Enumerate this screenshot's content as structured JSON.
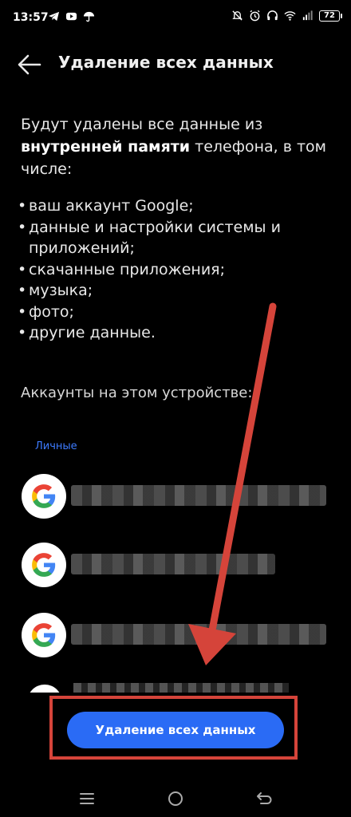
{
  "status_bar": {
    "time": "13:57",
    "battery": "72",
    "left_icons": [
      "telegram-icon",
      "youtube-icon",
      "umbrella-icon"
    ],
    "right_icons": [
      "mute-icon",
      "alarm-icon",
      "headphones-icon",
      "wifi-icon",
      "signal-icon"
    ]
  },
  "header": {
    "title": "Удаление всех данных"
  },
  "description": {
    "line_prefix": "Будут удалены все данные из ",
    "bold": "внутренней памяти",
    "line_suffix": " телефона, в том числе:"
  },
  "bullets": [
    "ваш аккаунт Google;",
    "данные и настройки системы и приложений;",
    "скачанные приложения;",
    "музыка;",
    "фото;",
    "другие данные."
  ],
  "accounts": {
    "header": "Аккаунты на этом устройстве:",
    "section_label": "Личные"
  },
  "actions": {
    "delete_label": "Удаление всех данных"
  },
  "colors": {
    "accent": "#2a6bf5",
    "highlight": "#d5443a",
    "section": "#3d7bff"
  }
}
